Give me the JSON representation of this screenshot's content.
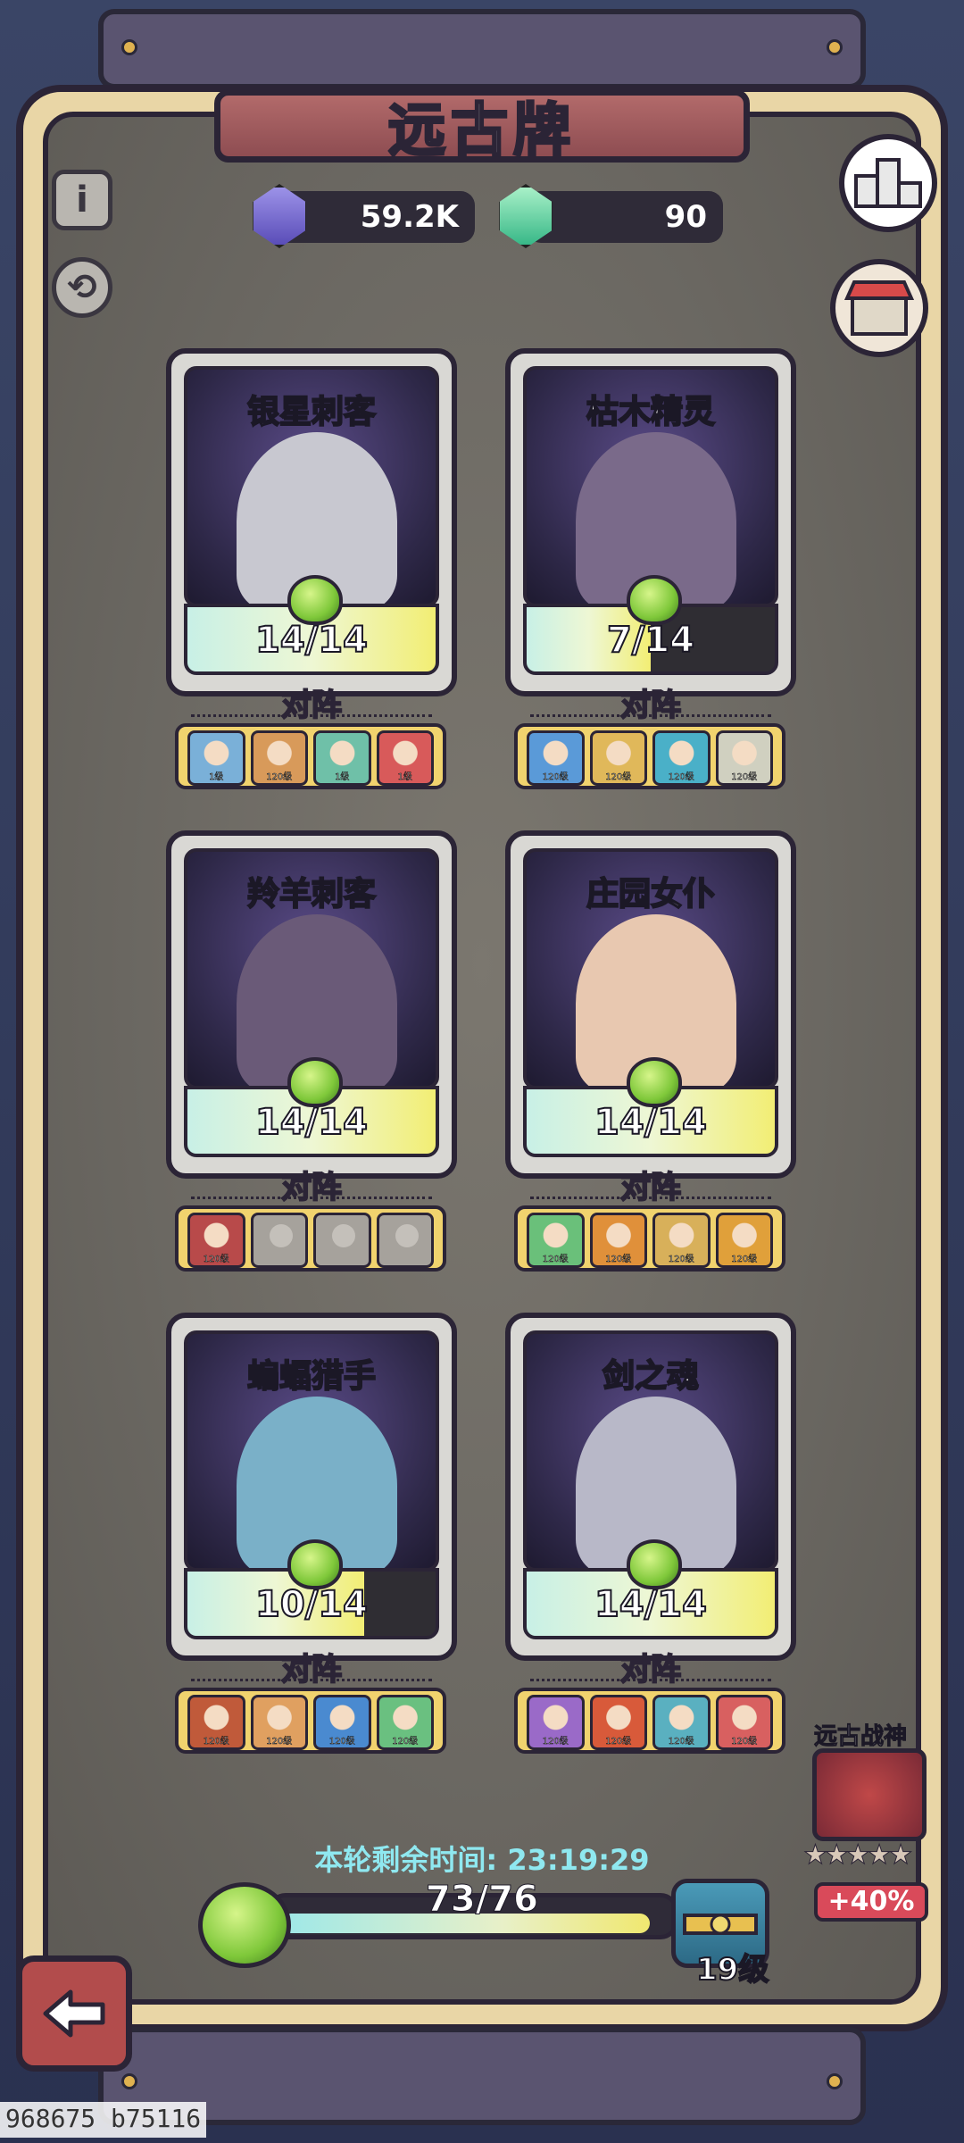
{
  "title": "远古牌",
  "currencies": [
    {
      "name": "purple-crystal",
      "value": "59.2K",
      "color": "#7a6fd0"
    },
    {
      "name": "green-crystal",
      "value": "90",
      "color": "#62d8a0"
    }
  ],
  "lineup_label": "对阵",
  "cards": [
    {
      "name": "银星刺客",
      "progress": "14/14",
      "fill": 1.0,
      "lineup": [
        {
          "level": "1级",
          "color": "#7ab0d8"
        },
        {
          "level": "120级",
          "color": "#d89a5a"
        },
        {
          "level": "1级",
          "color": "#6fc0a8"
        },
        {
          "level": "1级",
          "color": "#d85a5a"
        }
      ]
    },
    {
      "name": "枯木精灵",
      "progress": "7/14",
      "fill": 0.5,
      "lineup": [
        {
          "level": "120级",
          "color": "#5a9ad8"
        },
        {
          "level": "120级",
          "color": "#e0b85a"
        },
        {
          "level": "120级",
          "color": "#4ab0c8"
        },
        {
          "level": "120级",
          "color": "#d0d0c0"
        }
      ]
    },
    {
      "name": "羚羊刺客",
      "progress": "14/14",
      "fill": 1.0,
      "lineup": [
        {
          "level": "120级",
          "color": "#b84a4a"
        },
        {
          "level": "",
          "color": ""
        },
        {
          "level": "",
          "color": ""
        },
        {
          "level": "",
          "color": ""
        }
      ]
    },
    {
      "name": "庄园女仆",
      "progress": "14/14",
      "fill": 1.0,
      "lineup": [
        {
          "level": "120级",
          "color": "#6ac07a"
        },
        {
          "level": "120级",
          "color": "#e0903a"
        },
        {
          "level": "120级",
          "color": "#d8b05a"
        },
        {
          "level": "120级",
          "color": "#e0a03a"
        }
      ]
    },
    {
      "name": "蝙蝠猎手",
      "progress": "10/14",
      "fill": 0.714,
      "lineup": [
        {
          "level": "120级",
          "color": "#c05a3a"
        },
        {
          "level": "120级",
          "color": "#e0a060"
        },
        {
          "level": "120级",
          "color": "#4a8ad0"
        },
        {
          "level": "120级",
          "color": "#6ac080"
        }
      ]
    },
    {
      "name": "剑之魂",
      "progress": "14/14",
      "fill": 1.0,
      "lineup": [
        {
          "level": "120级",
          "color": "#9a6ac8"
        },
        {
          "level": "120级",
          "color": "#d85a3a"
        },
        {
          "level": "120级",
          "color": "#5ab0c0"
        },
        {
          "level": "120级",
          "color": "#d86060"
        }
      ]
    }
  ],
  "timer": "本轮剩余时间: 23:19:29",
  "total_progress": {
    "text": "73/76",
    "fill": 0.96
  },
  "chest_level": "19级",
  "war_god": {
    "name": "远古战神",
    "stars": "★★★★★",
    "bonus": "+40%"
  },
  "watermark": "968675 b75116"
}
